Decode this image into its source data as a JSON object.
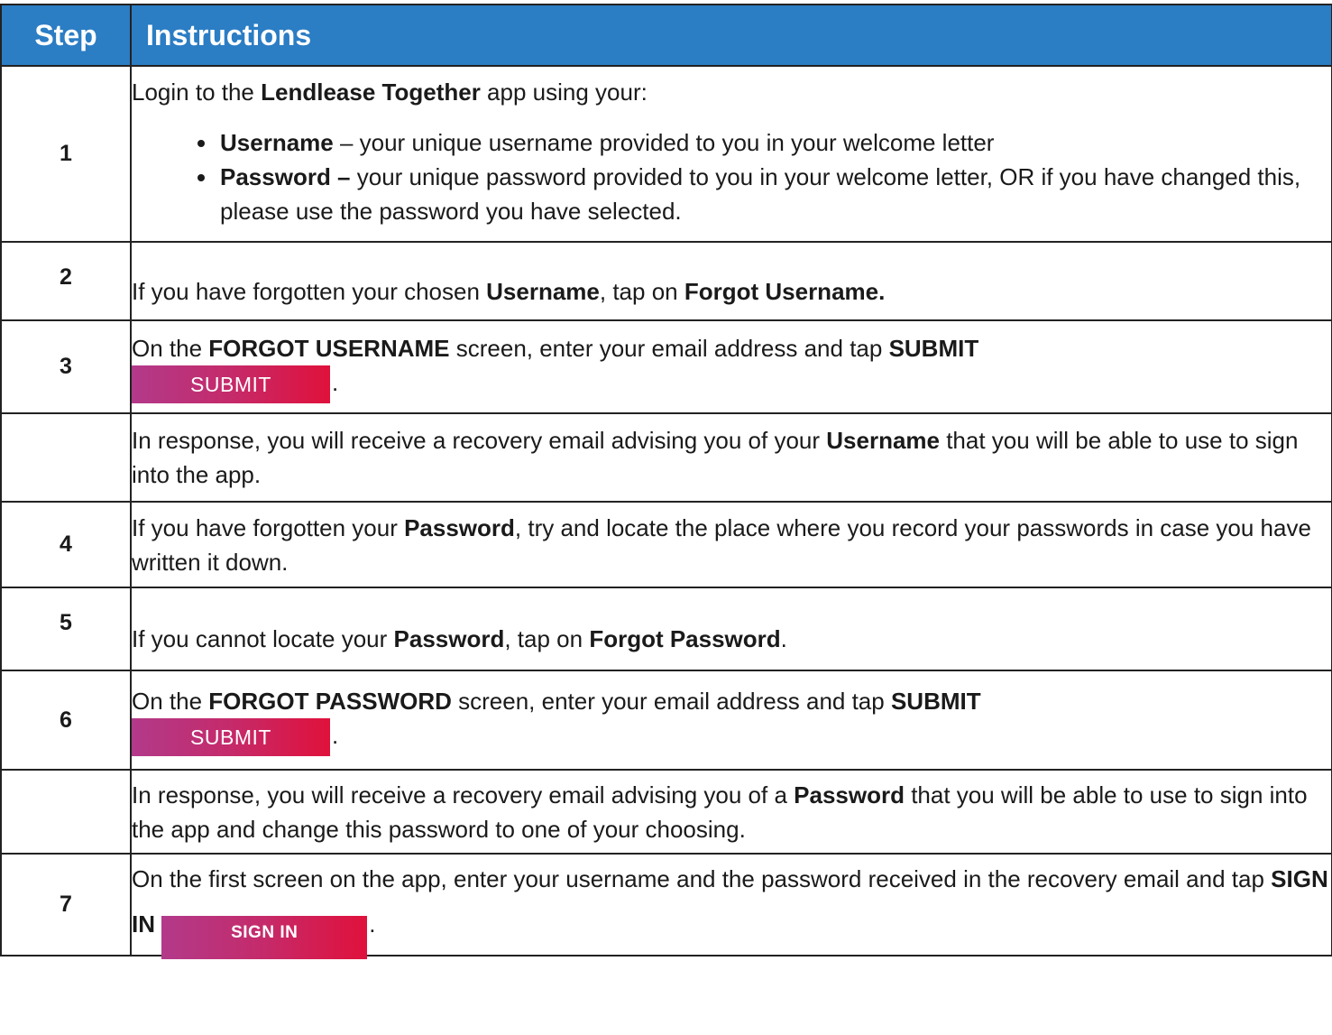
{
  "header": {
    "step": "Step",
    "instructions": "Instructions"
  },
  "rows": [
    {
      "step": "1",
      "intro": {
        "pre": "Login to the ",
        "b1": "Lendlease Together",
        "post": " app using your:"
      },
      "bullets": [
        {
          "bold": "Username",
          "text": " – your unique username provided to you in your welcome letter"
        },
        {
          "bold": "Password –",
          "text": " your unique password provided to you in your welcome letter, OR if you have changed this, please use the password you have selected."
        }
      ]
    },
    {
      "step": "2",
      "pre": "If you have forgotten your chosen ",
      "b1": "Username",
      "mid": ", tap on ",
      "b2": "Forgot Username."
    },
    {
      "step": "3",
      "pre": "On the ",
      "b1": "FORGOT USERNAME",
      "mid": " screen, enter your email address and tap ",
      "b2": "SUBMIT",
      "button": "SUBMIT",
      "end": "."
    },
    {
      "step": "",
      "pre": "In response, you will receive a recovery email advising you of your ",
      "b1": "Username",
      "post": " that you will be able to use to sign into the app."
    },
    {
      "step": "4",
      "pre": "If you have forgotten your ",
      "b1": "Password",
      "post": ", try and locate the place where you record your passwords in case you have written it down."
    },
    {
      "step": "5",
      "pre": "If you cannot locate your ",
      "b1": "Password",
      "mid": ", tap on ",
      "b2": "Forgot Password",
      "end": "."
    },
    {
      "step": "6",
      "pre": "On the ",
      "b1": "FORGOT PASSWORD",
      "mid": " screen, enter your email address and tap ",
      "b2": "SUBMIT",
      "button": "SUBMIT",
      "end": "."
    },
    {
      "step": "",
      "pre": "In response, you will receive a recovery email advising you of a ",
      "b1": "Password",
      "post": " that you will be able to use to sign into the app and change this password to one of your choosing."
    },
    {
      "step": "7",
      "pre": "On the first screen on the app, enter your username and the password received in the recovery email and tap ",
      "b1": "SIGN IN",
      "button": "SIGN IN",
      "end": "."
    }
  ],
  "colors": {
    "header_bg": "#2b7dc4",
    "button_gradient_start": "#b23a8a",
    "button_gradient_end": "#e0113b"
  }
}
